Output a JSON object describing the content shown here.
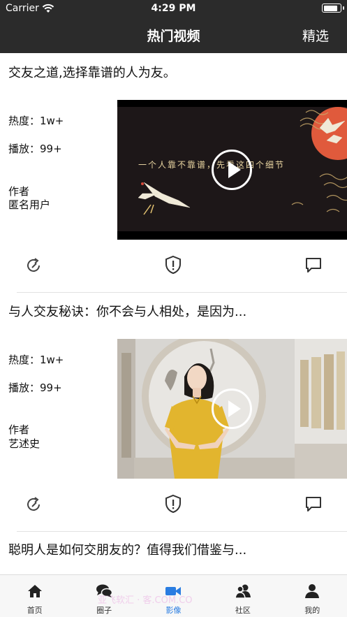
{
  "status_bar": {
    "carrier": "Carrier",
    "time": "4:29 PM",
    "battery_level": 0.9
  },
  "nav": {
    "title": "热门视频",
    "right_label": "精选"
  },
  "cards": [
    {
      "title": "交友之道,选择靠谱的人为友。",
      "heat": "热度：1w+",
      "plays": "播放：99+",
      "author_label": "作者",
      "author": "匿名用户",
      "overlay_text": "一个人靠不靠谱，先看这四个细节"
    },
    {
      "title": "与人交友秘诀：你不会与人相处，是因为...",
      "heat": "热度：1w+",
      "plays": "播放：99+",
      "author_label": "作者",
      "author": "艺述史"
    },
    {
      "title": "聪明人是如何交朋友的？值得我们借鉴与..."
    }
  ],
  "tabs": [
    {
      "label": "首页",
      "icon": "home-icon",
      "active": false
    },
    {
      "label": "圈子",
      "icon": "chat-icon",
      "active": false
    },
    {
      "label": "影像",
      "icon": "video-icon",
      "active": true
    },
    {
      "label": "社区",
      "icon": "community-icon",
      "active": false
    },
    {
      "label": "我的",
      "icon": "profile-icon",
      "active": false
    }
  ],
  "watermark": "亚飞软汇 · 客.COM.CO",
  "colors": {
    "bar": "#2b2b2b",
    "active_tab": "#2a7de1",
    "cheongsam": "#e2b52e",
    "accent_red": "#e05a3c"
  }
}
